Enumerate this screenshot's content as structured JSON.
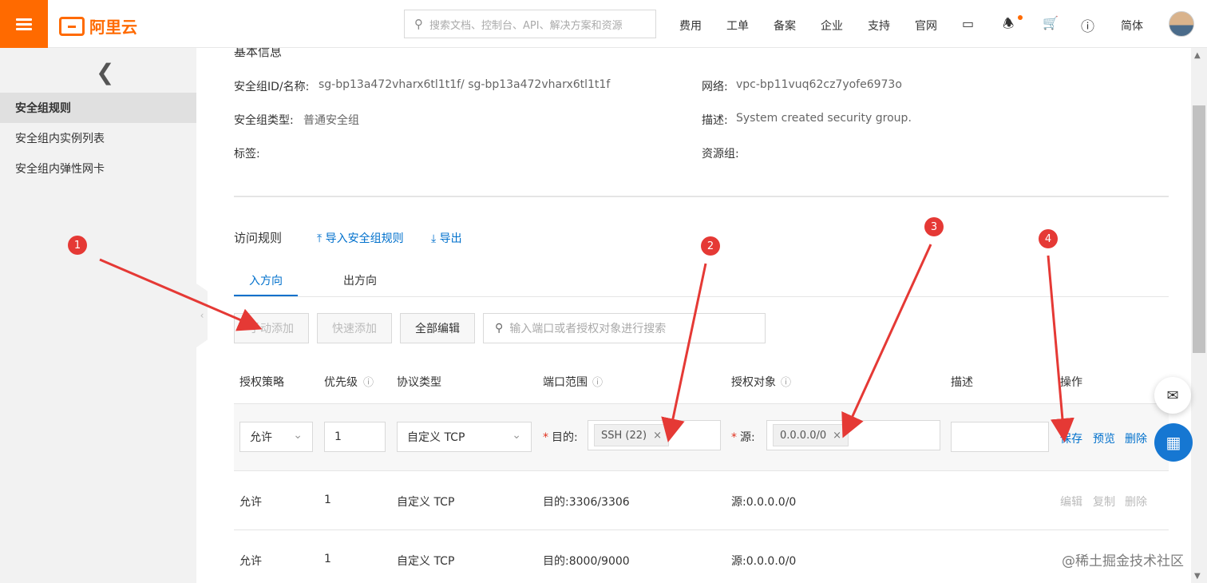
{
  "topbar": {
    "logo_text": "阿里云",
    "search_placeholder": "搜索文档、控制台、API、解决方案和资源",
    "nav": [
      "费用",
      "工单",
      "备案",
      "企业",
      "支持",
      "官网"
    ],
    "lang": "简体",
    "accent_color": "#ff6a00"
  },
  "sidebar": {
    "items": [
      "安全组规则",
      "安全组内实例列表",
      "安全组内弹性网卡"
    ]
  },
  "basic": {
    "heading": "基本信息",
    "id_label": "安全组ID/名称:",
    "id_value": "sg-bp13a472vharx6tl1t1f/ sg-bp13a472vharx6tl1t1f",
    "network_label": "网络:",
    "network_value": "vpc-bp11vuq62cz7yofe6973o",
    "type_label": "安全组类型:",
    "type_value": "普通安全组",
    "desc_label": "描述:",
    "desc_value": "System created security group.",
    "tags_label": "标签:",
    "rg_label": "资源组:"
  },
  "rules": {
    "heading": "访问规则",
    "import_label": "导入安全组规则",
    "export_label": "导出",
    "tab_in": "入方向",
    "tab_out": "出方向",
    "btn_manual": "手动添加",
    "btn_quick": "快速添加",
    "btn_edit_all": "全部编辑",
    "search_placeholder": "输入端口或者授权对象进行搜索",
    "columns": [
      "授权策略",
      "优先级",
      "协议类型",
      "端口范围",
      "授权对象",
      "描述",
      "操作"
    ],
    "edit_row": {
      "policy": "允许",
      "priority": "1",
      "protocol": "自定义 TCP",
      "port_label": "目的:",
      "port_tag": "SSH (22)",
      "source_label": "源:",
      "source_tag": "0.0.0.0/0",
      "save": "保存",
      "preview": "预览",
      "delete": "删除"
    },
    "rows": [
      {
        "policy": "允许",
        "priority": "1",
        "protocol": "自定义 TCP",
        "port": "目的:3306/3306",
        "source": "源:0.0.0.0/0",
        "edit": "编辑",
        "copy": "复制",
        "delete": "删除"
      },
      {
        "policy": "允许",
        "priority": "1",
        "protocol": "自定义 TCP",
        "port": "目的:8000/9000",
        "source": "源:0.0.0.0/0"
      }
    ]
  },
  "annotations": [
    "1",
    "2",
    "3",
    "4"
  ],
  "watermark": "@稀土掘金技术社区"
}
